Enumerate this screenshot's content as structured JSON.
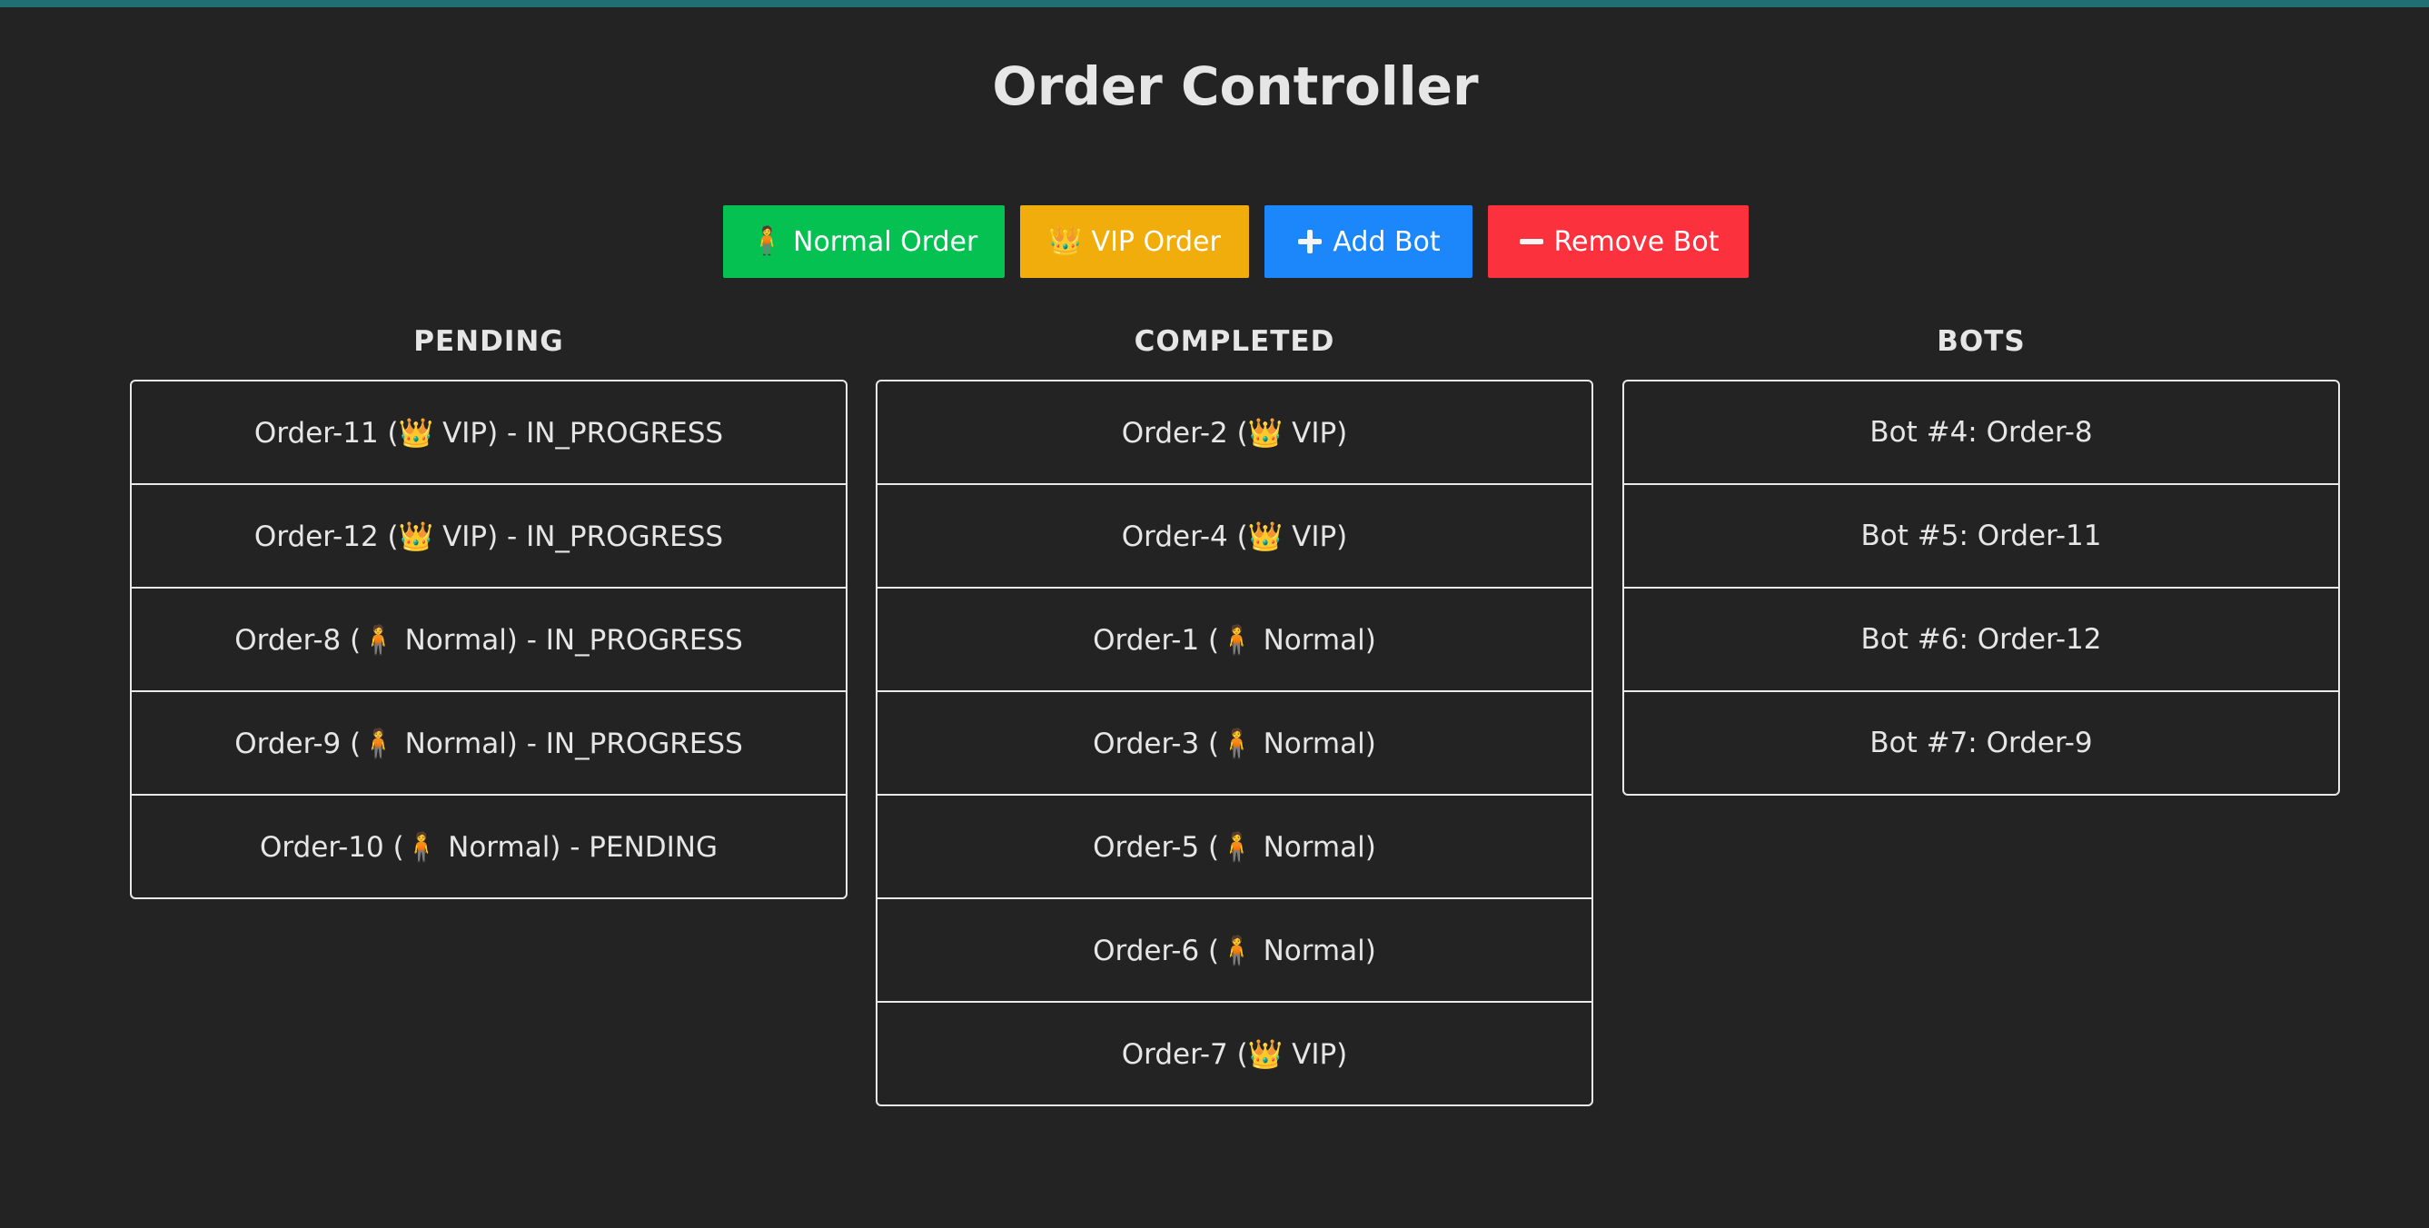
{
  "title": "Order Controller",
  "buttons": {
    "normal_order": {
      "icon": "🧍",
      "label": "Normal Order"
    },
    "vip_order": {
      "icon": "👑",
      "label": "VIP Order"
    },
    "add_bot": {
      "icon": "plus-icon",
      "label": "Add Bot"
    },
    "remove_bot": {
      "icon": "minus-icon",
      "label": "Remove Bot"
    }
  },
  "colors": {
    "background": "#232323",
    "normal_order": "#05c152",
    "vip_order": "#f0ad0c",
    "add_bot": "#1c86fb",
    "remove_bot": "#fb323e",
    "top_strip": "#1f6f73"
  },
  "pending": {
    "heading": "PENDING",
    "items": [
      "Order-11 (👑 VIP) - IN_PROGRESS",
      "Order-12 (👑 VIP) - IN_PROGRESS",
      "Order-8 (🧍 Normal) - IN_PROGRESS",
      "Order-9 (🧍 Normal) - IN_PROGRESS",
      "Order-10 (🧍 Normal) - PENDING"
    ]
  },
  "completed": {
    "heading": "COMPLETED",
    "items": [
      "Order-2 (👑 VIP)",
      "Order-4 (👑 VIP)",
      "Order-1 (🧍 Normal)",
      "Order-3 (🧍 Normal)",
      "Order-5 (🧍 Normal)",
      "Order-6 (🧍 Normal)",
      "Order-7 (👑 VIP)"
    ]
  },
  "bots": {
    "heading": "BOTS",
    "items": [
      "Bot #4: Order-8",
      "Bot #5: Order-11",
      "Bot #6: Order-12",
      "Bot #7: Order-9"
    ]
  }
}
